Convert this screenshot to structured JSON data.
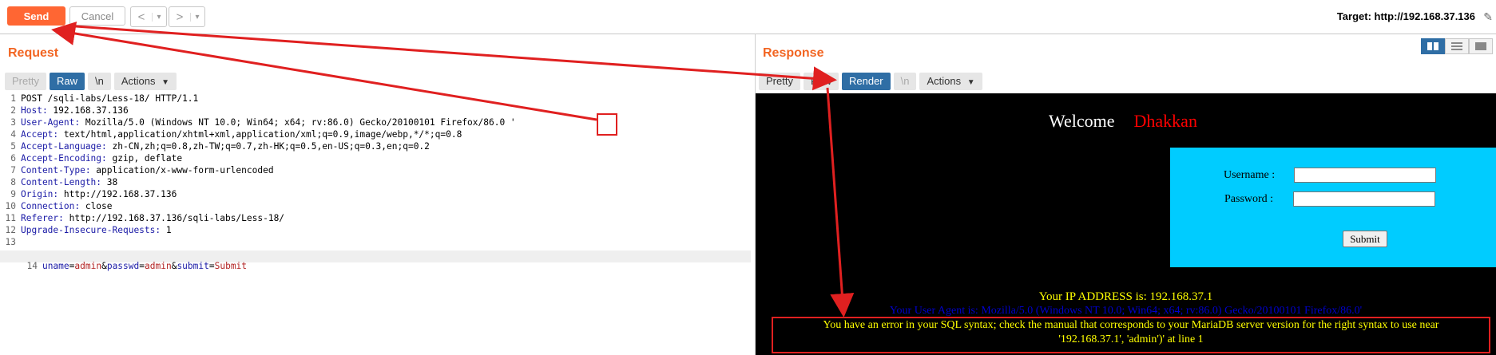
{
  "toolbar": {
    "send_label": "Send",
    "cancel_label": "Cancel",
    "back_label": "<",
    "forward_label": ">",
    "dropdown_glyph": "▾",
    "target_label": "Target: http://192.168.37.136"
  },
  "request": {
    "title": "Request",
    "tabs": [
      "Pretty",
      "Raw",
      "\\n",
      "Actions"
    ],
    "active_tab": "Raw",
    "lines": [
      {
        "n": "1",
        "name": "",
        "value": "POST /sqli-labs/Less-18/ HTTP/1.1"
      },
      {
        "n": "2",
        "name": "Host:",
        "value": " 192.168.37.136"
      },
      {
        "n": "3",
        "name": "User-Agent:",
        "value": " Mozilla/5.0 (Windows NT 10.0; Win64; x64; rv:86.0) Gecko/20100101 Firefox/86.0 '"
      },
      {
        "n": "4",
        "name": "Accept:",
        "value": " text/html,application/xhtml+xml,application/xml;q=0.9,image/webp,*/*;q=0.8"
      },
      {
        "n": "5",
        "name": "Accept-Language:",
        "value": " zh-CN,zh;q=0.8,zh-TW;q=0.7,zh-HK;q=0.5,en-US;q=0.3,en;q=0.2"
      },
      {
        "n": "6",
        "name": "Accept-Encoding:",
        "value": " gzip, deflate"
      },
      {
        "n": "7",
        "name": "Content-Type:",
        "value": " application/x-www-form-urlencoded"
      },
      {
        "n": "8",
        "name": "Content-Length:",
        "value": " 38"
      },
      {
        "n": "9",
        "name": "Origin:",
        "value": " http://192.168.37.136"
      },
      {
        "n": "10",
        "name": "Connection:",
        "value": " close"
      },
      {
        "n": "11",
        "name": "Referer:",
        "value": " http://192.168.37.136/sqli-labs/Less-18/"
      },
      {
        "n": "12",
        "name": "Upgrade-Insecure-Requests:",
        "value": " 1"
      },
      {
        "n": "13",
        "name": "",
        "value": ""
      }
    ],
    "body_line_number": "14",
    "body_params": [
      {
        "key": "uname",
        "value": "admin"
      },
      {
        "key": "passwd",
        "value": "admin"
      },
      {
        "key": "submit",
        "value": "Submit"
      }
    ]
  },
  "response": {
    "title": "Response",
    "tabs": [
      "Pretty",
      "Raw",
      "Render",
      "\\n",
      "Actions"
    ],
    "active_tab": "Render",
    "render": {
      "welcome": "Welcome",
      "name": "Dhakkan",
      "username_label": "Username :",
      "password_label": "Password :",
      "submit_label": "Submit",
      "ip_text": "Your IP ADDRESS is: 192.168.37.1",
      "ua_text": "Your User Agent is: Mozilla/5.0 (Windows NT 10.0; Win64; x64; rv:86.0) Gecko/20100101 Firefox/86.0'",
      "error_line1": "You have an error in your SQL syntax; check the manual that corresponds to your MariaDB server version for the right syntax to use near",
      "error_line2": "'192.168.37.1', 'admin')' at line 1"
    }
  },
  "colors": {
    "accent": "#ff6633",
    "active_tab": "#2f6ea5",
    "annotation": "#e02020",
    "form_bg": "#00ccff"
  }
}
